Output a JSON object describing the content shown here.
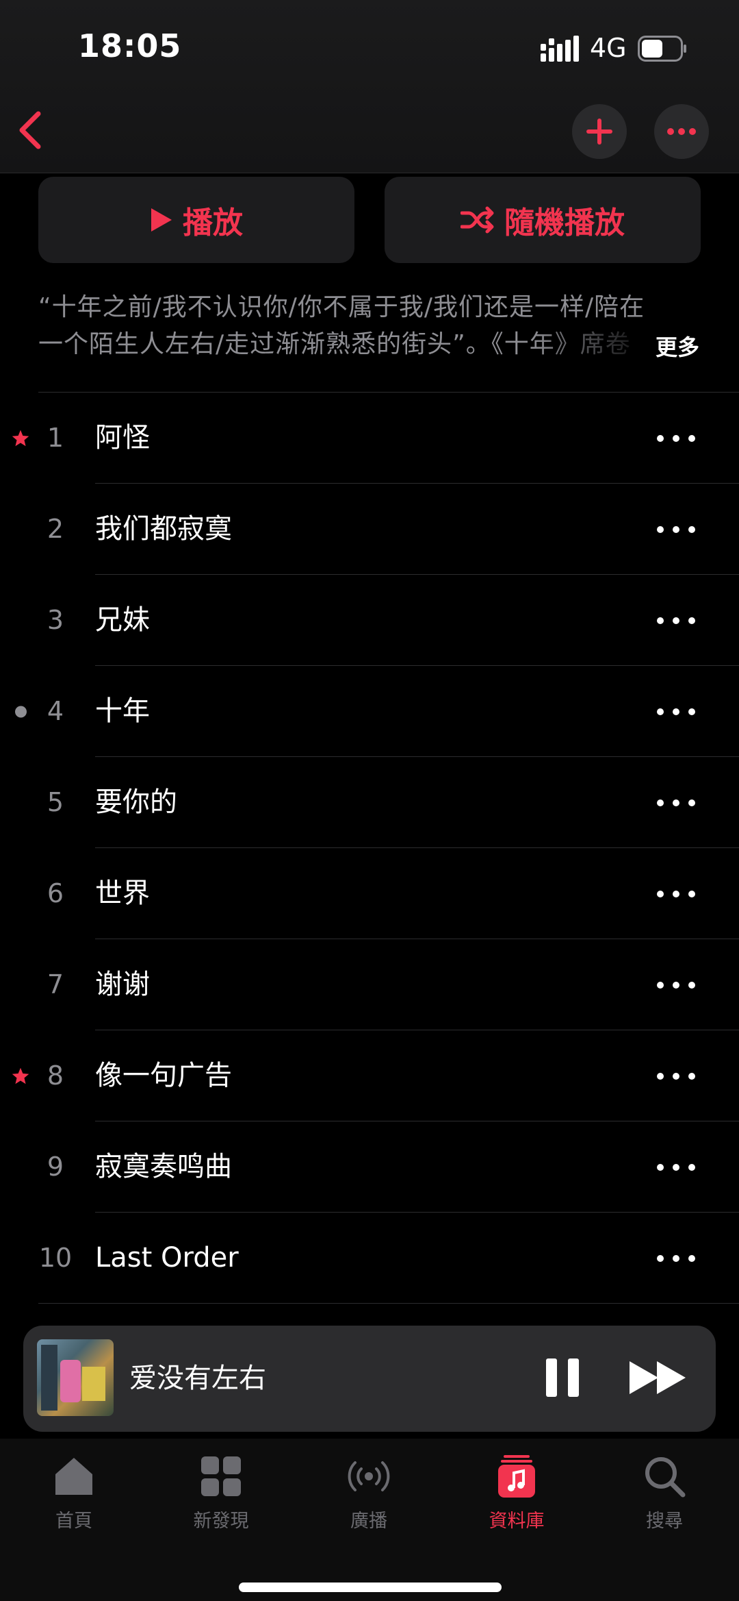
{
  "status_bar": {
    "time": "18:05",
    "network": "4G"
  },
  "actions": {
    "play_label": "播放",
    "shuffle_label": "隨機播放"
  },
  "description": {
    "line1": "“十年之前/我不认识你/你不属于我/我们还是一样/陪在",
    "line2": "一个陌生人左右/走过渐渐熟悉的街头”。《十年》席卷",
    "more_label": "更多"
  },
  "tracks": [
    {
      "number": "1",
      "title": "阿怪",
      "marker": "star"
    },
    {
      "number": "2",
      "title": "我们都寂寞",
      "marker": ""
    },
    {
      "number": "3",
      "title": "兄妹",
      "marker": ""
    },
    {
      "number": "4",
      "title": "十年",
      "marker": "dot"
    },
    {
      "number": "5",
      "title": "要你的",
      "marker": ""
    },
    {
      "number": "6",
      "title": "世界",
      "marker": ""
    },
    {
      "number": "7",
      "title": "谢谢",
      "marker": ""
    },
    {
      "number": "8",
      "title": "像一句广告",
      "marker": "star"
    },
    {
      "number": "9",
      "title": "寂寞奏鸣曲",
      "marker": ""
    },
    {
      "number": "10",
      "title": "Last Order",
      "marker": ""
    }
  ],
  "now_playing": {
    "title": "爱没有左右"
  },
  "tabs": [
    {
      "label": "首頁",
      "icon": "home-icon",
      "active": false
    },
    {
      "label": "新發現",
      "icon": "grid-icon",
      "active": false
    },
    {
      "label": "廣播",
      "icon": "radio-icon",
      "active": false
    },
    {
      "label": "資料庫",
      "icon": "library-icon",
      "active": true
    },
    {
      "label": "搜尋",
      "icon": "search-icon",
      "active": false
    }
  ],
  "colors": {
    "accent": "#f2344f",
    "background": "#000000",
    "secondary_text": "#8e8e93"
  }
}
